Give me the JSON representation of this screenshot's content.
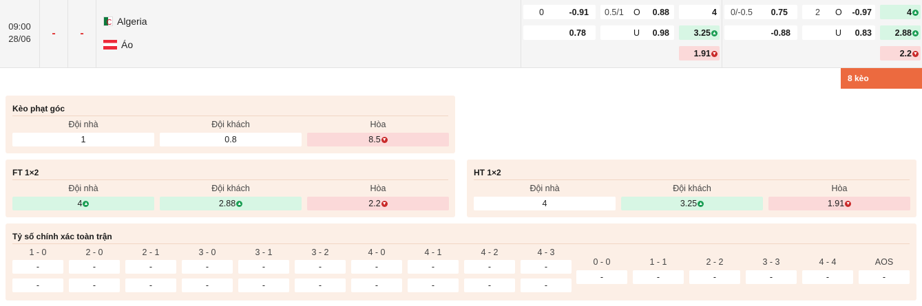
{
  "match": {
    "time": "09:00",
    "date": "28/06",
    "score_ft": "-",
    "score_ht": "-",
    "home_team": "Algeria",
    "away_team": "Áo"
  },
  "odds": {
    "hdp_ft": {
      "home_line": "0",
      "home_odds": "-0.91",
      "away_odds": "0.78"
    },
    "ou_ft": {
      "line": "0.5/1",
      "over_label": "O",
      "over_odds": "0.88",
      "under_label": "U",
      "under_odds": "0.98"
    },
    "x12_ft": {
      "home": "4",
      "away": "3.25",
      "draw": "1.91"
    },
    "hdp_ht": {
      "home_line": "0/-0.5",
      "home_odds": "0.75",
      "away_odds": "-0.88"
    },
    "ou_ht": {
      "line": "2",
      "over_label": "O",
      "over_odds": "-0.97",
      "under_label": "U",
      "under_odds": "0.83"
    },
    "x12_ht": {
      "home": "4",
      "away": "2.88",
      "draw": "2.2"
    }
  },
  "more_button": "8 kèo",
  "corner": {
    "title": "Kèo phạt góc",
    "headers": [
      "Đội nhà",
      "Đội khách",
      "Hòa"
    ],
    "values": [
      "1",
      "0.8",
      "8.5"
    ]
  },
  "ft1x2": {
    "title": "FT 1×2",
    "headers": [
      "Đội nhà",
      "Đội khách",
      "Hòa"
    ],
    "values": [
      "4",
      "2.88",
      "2.2"
    ]
  },
  "ht1x2": {
    "title": "HT 1×2",
    "headers": [
      "Đội nhà",
      "Đội khách",
      "Hòa"
    ],
    "values": [
      "4",
      "3.25",
      "1.91"
    ]
  },
  "correct_score": {
    "title": "Tỷ số chính xác toàn trận",
    "columns": [
      "1 - 0",
      "2 - 0",
      "2 - 1",
      "3 - 0",
      "3 - 1",
      "3 - 2",
      "4 - 0",
      "4 - 1",
      "4 - 2",
      "4 - 3"
    ],
    "row1": [
      "-",
      "-",
      "-",
      "-",
      "-",
      "-",
      "-",
      "-",
      "-",
      "-"
    ],
    "row2": [
      "-",
      "-",
      "-",
      "-",
      "-",
      "-",
      "-",
      "-",
      "-",
      "-"
    ],
    "draw_columns": [
      "0 - 0",
      "1 - 1",
      "2 - 2",
      "3 - 3",
      "4 - 4",
      "AOS"
    ],
    "draw_row": [
      "-",
      "-",
      "-",
      "-",
      "-",
      "-"
    ]
  },
  "colors": {
    "accent": "#ec6a3f",
    "up": "#1b9e54",
    "down": "#c92a2a",
    "card_bg": "#fcefe6"
  },
  "icons": {
    "up": "arrow-up-circle-icon",
    "down": "arrow-down-circle-icon"
  }
}
